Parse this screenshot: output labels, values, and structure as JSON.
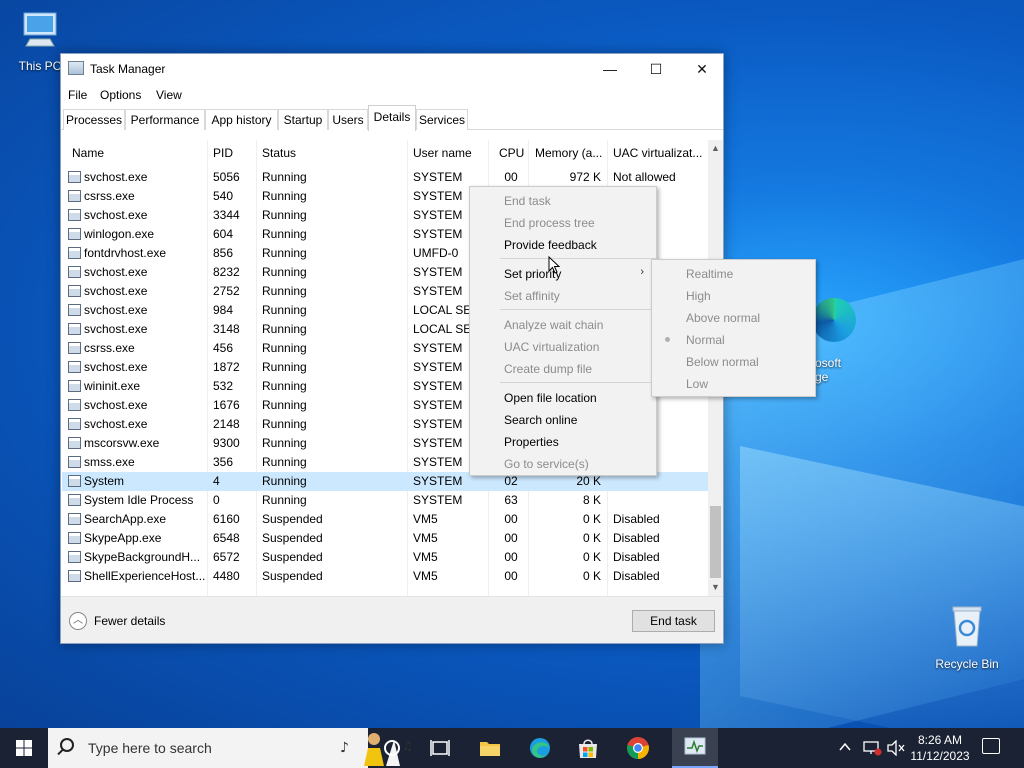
{
  "desktop": {
    "icons": [
      {
        "label": "This PC"
      },
      {
        "label": "Recycle Bin"
      }
    ],
    "edge_partial_label": "osoft\nge"
  },
  "window": {
    "title": "Task Manager",
    "controls": {
      "minimize": "—",
      "maximize": "☐",
      "close": "✕"
    },
    "menu": [
      "File",
      "Options",
      "View"
    ],
    "tabs": [
      "Processes",
      "Performance",
      "App history",
      "Startup",
      "Users",
      "Details",
      "Services"
    ],
    "active_tab": "Details"
  },
  "table": {
    "columns": [
      "Name",
      "PID",
      "Status",
      "User name",
      "CPU",
      "Memory (a...",
      "UAC virtualizat..."
    ],
    "rows": [
      [
        "svchost.exe",
        "5056",
        "Running",
        "SYSTEM",
        "00",
        "972 K",
        "Not allowed"
      ],
      [
        "csrss.exe",
        "540",
        "Running",
        "SYSTEM",
        "",
        "",
        "owed"
      ],
      [
        "svchost.exe",
        "3344",
        "Running",
        "SYSTEM",
        "",
        "",
        "owed"
      ],
      [
        "winlogon.exe",
        "604",
        "Running",
        "SYSTEM",
        "",
        "",
        "owed"
      ],
      [
        "fontdrvhost.exe",
        "856",
        "Running",
        "UMFD-0",
        "",
        "",
        ""
      ],
      [
        "svchost.exe",
        "8232",
        "Running",
        "SYSTEM",
        "",
        "",
        ""
      ],
      [
        "svchost.exe",
        "2752",
        "Running",
        "SYSTEM",
        "",
        "",
        ""
      ],
      [
        "svchost.exe",
        "984",
        "Running",
        "LOCAL SE...",
        "",
        "",
        ""
      ],
      [
        "svchost.exe",
        "3148",
        "Running",
        "LOCAL SE...",
        "",
        "",
        ""
      ],
      [
        "csrss.exe",
        "456",
        "Running",
        "SYSTEM",
        "",
        "",
        ""
      ],
      [
        "svchost.exe",
        "1872",
        "Running",
        "SYSTEM",
        "",
        "",
        ""
      ],
      [
        "wininit.exe",
        "532",
        "Running",
        "SYSTEM",
        "",
        "",
        ""
      ],
      [
        "svchost.exe",
        "1676",
        "Running",
        "SYSTEM",
        "",
        "",
        "owed"
      ],
      [
        "svchost.exe",
        "2148",
        "Running",
        "SYSTEM",
        "",
        "",
        "owed"
      ],
      [
        "mscorsvw.exe",
        "9300",
        "Running",
        "SYSTEM",
        "",
        "",
        "owed"
      ],
      [
        "smss.exe",
        "356",
        "Running",
        "SYSTEM",
        "",
        "",
        "owed"
      ],
      [
        "System",
        "4",
        "Running",
        "SYSTEM",
        "02",
        "20 K",
        ""
      ],
      [
        "System Idle Process",
        "0",
        "Running",
        "SYSTEM",
        "63",
        "8 K",
        ""
      ],
      [
        "SearchApp.exe",
        "6160",
        "Suspended",
        "VM5",
        "00",
        "0 K",
        "Disabled"
      ],
      [
        "SkypeApp.exe",
        "6548",
        "Suspended",
        "VM5",
        "00",
        "0 K",
        "Disabled"
      ],
      [
        "SkypeBackgroundH...",
        "6572",
        "Suspended",
        "VM5",
        "00",
        "0 K",
        "Disabled"
      ],
      [
        "ShellExperienceHost...",
        "4480",
        "Suspended",
        "VM5",
        "00",
        "0 K",
        "Disabled"
      ]
    ],
    "selected_row": 16
  },
  "footer": {
    "fewer_details": "Fewer details",
    "end_task": "End task"
  },
  "context_menu": {
    "items": [
      {
        "label": "End task",
        "enabled": false
      },
      {
        "label": "End process tree",
        "enabled": false
      },
      {
        "label": "Provide feedback",
        "enabled": true
      },
      {
        "label": "Set priority",
        "enabled": true,
        "submenu": true
      },
      {
        "label": "Set affinity",
        "enabled": false
      },
      {
        "label": "Analyze wait chain",
        "enabled": false
      },
      {
        "label": "UAC virtualization",
        "enabled": false
      },
      {
        "label": "Create dump file",
        "enabled": false
      },
      {
        "label": "Open file location",
        "enabled": true
      },
      {
        "label": "Search online",
        "enabled": true
      },
      {
        "label": "Properties",
        "enabled": true
      },
      {
        "label": "Go to service(s)",
        "enabled": false
      }
    ]
  },
  "priority_submenu": {
    "items": [
      "Realtime",
      "High",
      "Above normal",
      "Normal",
      "Below normal",
      "Low"
    ],
    "selected": "Normal"
  },
  "taskbar": {
    "search_placeholder": "Type here to search",
    "time": "8:26 AM",
    "date": "11/12/2023"
  },
  "colors": {
    "selection": "#cce8ff",
    "taskbar": "#1b2233",
    "disabled_text": "#8c8c8c"
  }
}
